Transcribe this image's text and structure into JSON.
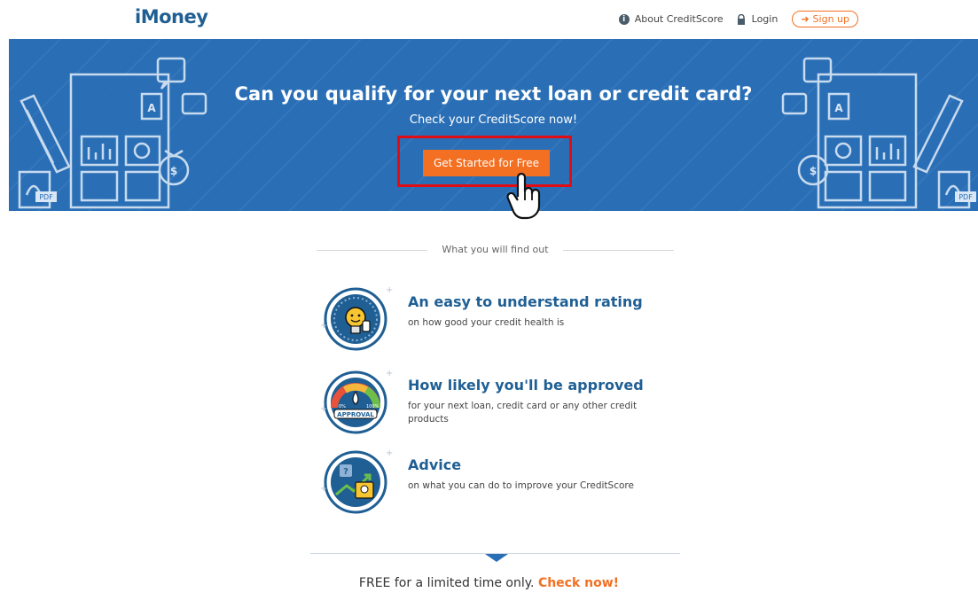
{
  "header": {
    "logo": "iMoney",
    "nav": {
      "about": "About CreditScore",
      "login": "Login",
      "signup": "Sign up"
    }
  },
  "hero": {
    "title": "Can you qualify for your next loan or credit card?",
    "subtitle": "Check your CreditScore now!",
    "cta": "Get Started for Free",
    "pdf_label": "PDF",
    "letter_label": "A"
  },
  "section": {
    "heading": "What you will find out",
    "features": [
      {
        "title": "An easy to understand rating",
        "desc": "on how good your credit health is",
        "icon": "lightbulb-gauge-icon"
      },
      {
        "title": "How likely you'll be approved",
        "desc": "for your next loan, credit card or any other credit products",
        "icon": "approval-gauge-icon",
        "gauge_min": "0%",
        "gauge_max": "100%",
        "gauge_label": "APPROVAL"
      },
      {
        "title": "Advice",
        "desc": "on what you can do to improve your CreditScore",
        "icon": "advice-chart-icon"
      }
    ]
  },
  "footer_cta": {
    "free": "FREE",
    "text": " for a limited time only. ",
    "check": "Check now!"
  },
  "colors": {
    "brand_blue": "#2a6fb6",
    "accent_orange": "#f36f21",
    "highlight_red": "#e10d12",
    "title_blue": "#1f5f94"
  }
}
